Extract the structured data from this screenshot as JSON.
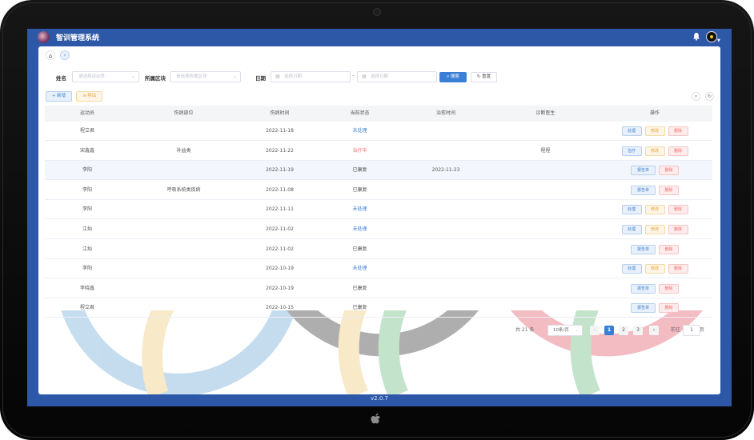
{
  "app": {
    "title": "智训管理系统",
    "version": "v2.0.7"
  },
  "filters": {
    "name_label": "姓名",
    "name_placeholder": "请选择运动员",
    "region_label": "所属区块",
    "region_placeholder": "请选择所属区块",
    "date_label": "日期",
    "start_placeholder": "选择日期",
    "end_placeholder": "选择日期",
    "date_separator": "-",
    "search_label": "搜索",
    "reset_label": "重置"
  },
  "toolbar": {
    "add_label": "+ 新增",
    "export_label": "导出"
  },
  "table": {
    "headers": [
      "运动员",
      "伤病部位",
      "伤病时间",
      "当前状态",
      "治愈时间",
      "诊断医生",
      "操作"
    ],
    "rows": [
      {
        "athlete": "程立君",
        "part": "",
        "date": "2022-11-18",
        "status": "未处理",
        "status_type": "pending",
        "cured": "",
        "doctor": "",
        "ops": [
          "处理",
          "修改",
          "删除"
        ]
      },
      {
        "athlete": "宋鑫鑫",
        "part": "补益类",
        "date": "2022-11-22",
        "status": "治疗中",
        "status_type": "treating",
        "cured": "",
        "doctor": "程程",
        "ops": [
          "治疗",
          "修改",
          "删除"
        ]
      },
      {
        "athlete": "李阳",
        "part": "",
        "date": "2022-11-19",
        "status": "已康复",
        "status_type": "done",
        "cured": "2022-11-23",
        "doctor": "",
        "ops": [
          "报告单",
          "删除"
        ]
      },
      {
        "athlete": "李阳",
        "part": "呼吸系统类疾病",
        "date": "2022-11-08",
        "status": "已康复",
        "status_type": "done",
        "cured": "",
        "doctor": "",
        "ops": [
          "报告单",
          "删除"
        ]
      },
      {
        "athlete": "李阳",
        "part": "",
        "date": "2022-11-11",
        "status": "未处理",
        "status_type": "pending",
        "cured": "",
        "doctor": "",
        "ops": [
          "处理",
          "修改",
          "删除"
        ]
      },
      {
        "athlete": "江灿",
        "part": "",
        "date": "2022-11-02",
        "status": "未处理",
        "status_type": "pending",
        "cured": "",
        "doctor": "",
        "ops": [
          "处理",
          "修改",
          "删除"
        ]
      },
      {
        "athlete": "江灿",
        "part": "",
        "date": "2022-11-02",
        "status": "已康复",
        "status_type": "done",
        "cured": "",
        "doctor": "",
        "ops": [
          "报告单",
          "删除"
        ]
      },
      {
        "athlete": "李阳",
        "part": "",
        "date": "2022-10-19",
        "status": "未处理",
        "status_type": "pending",
        "cured": "",
        "doctor": "",
        "ops": [
          "处理",
          "修改",
          "删除"
        ]
      },
      {
        "athlete": "李晓鑫",
        "part": "",
        "date": "2022-10-19",
        "status": "已康复",
        "status_type": "done",
        "cured": "",
        "doctor": "",
        "ops": [
          "报告单",
          "删除"
        ]
      },
      {
        "athlete": "程立君",
        "part": "",
        "date": "2022-10-15",
        "status": "已康复",
        "status_type": "done",
        "cured": "",
        "doctor": "",
        "ops": [
          "报告单",
          "删除"
        ]
      }
    ]
  },
  "pagination": {
    "total_text": "共 21 条",
    "page_size": "10条/页",
    "pages": [
      "1",
      "2",
      "3"
    ],
    "current": "1",
    "goto_label": "前往",
    "goto_value": "1",
    "page_unit": "页"
  },
  "colors": {
    "primary": "#3a7fd5",
    "header": "#2d58a8",
    "danger": "#f56c6c",
    "warning": "#e6a23c"
  }
}
